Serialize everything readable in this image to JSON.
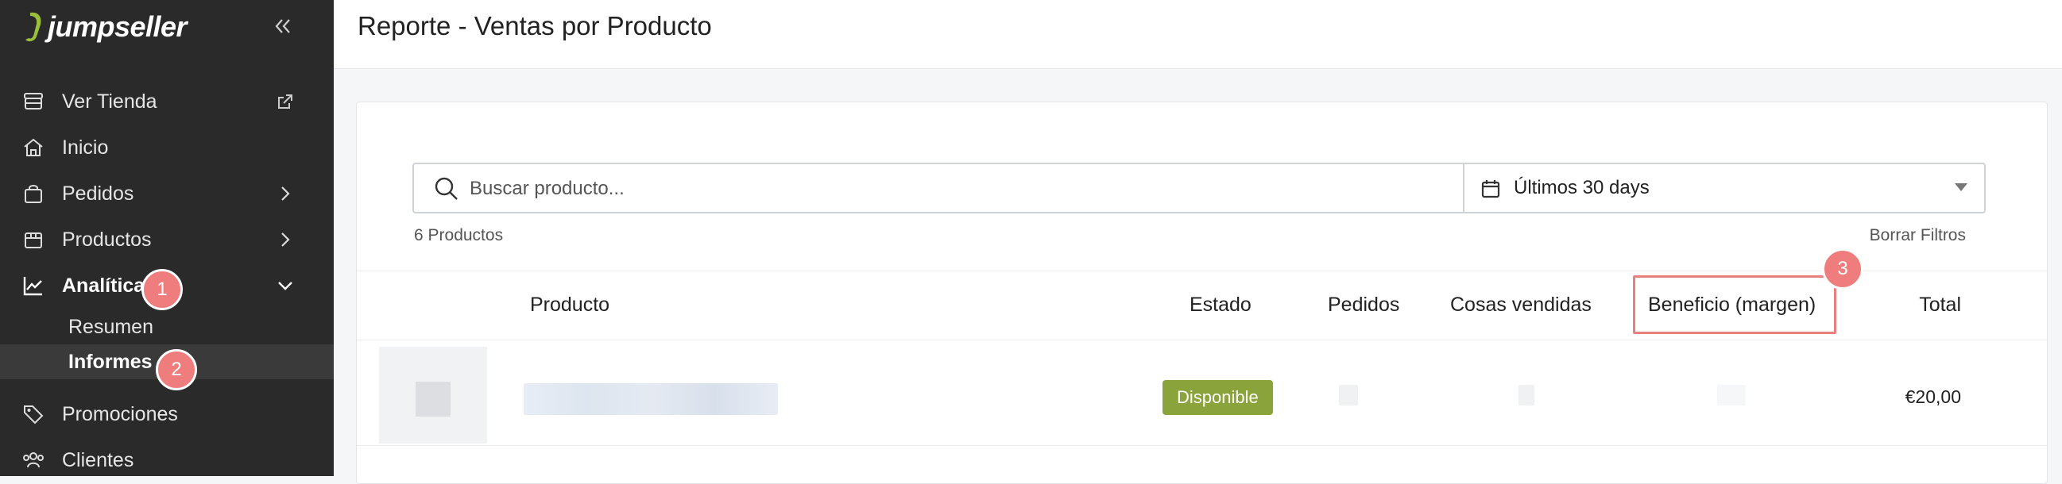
{
  "brand": {
    "name": "jumpseller"
  },
  "sidebar": {
    "items": [
      {
        "label": "Ver Tienda",
        "icon": "store-icon"
      },
      {
        "label": "Inicio",
        "icon": "home-icon"
      },
      {
        "label": "Pedidos",
        "icon": "bag-icon"
      },
      {
        "label": "Productos",
        "icon": "box-icon"
      },
      {
        "label": "Analítica",
        "icon": "chart-icon"
      },
      {
        "label": "Promociones",
        "icon": "tag-icon"
      },
      {
        "label": "Clientes",
        "icon": "users-icon"
      }
    ],
    "subitems": [
      {
        "label": "Resumen"
      },
      {
        "label": "Informes"
      }
    ]
  },
  "callouts": [
    "1",
    "2",
    "3"
  ],
  "header": {
    "title": "Reporte - Ventas por Producto"
  },
  "filters": {
    "search_placeholder": "Buscar producto...",
    "date_range": "Últimos 30 days",
    "count": "6 Productos",
    "clear": "Borrar Filtros"
  },
  "table": {
    "columns": [
      "Producto",
      "Estado",
      "Pedidos",
      "Cosas vendidas",
      "Beneficio (margen)",
      "Total"
    ],
    "rows": [
      {
        "status": "Disponible",
        "total": "€20,00"
      }
    ]
  },
  "colors": {
    "sidebar": "#2a2a2a",
    "badge": "#8aa33a",
    "callout": "#f07d7d",
    "brand_leaf": "#9bbf3a"
  }
}
